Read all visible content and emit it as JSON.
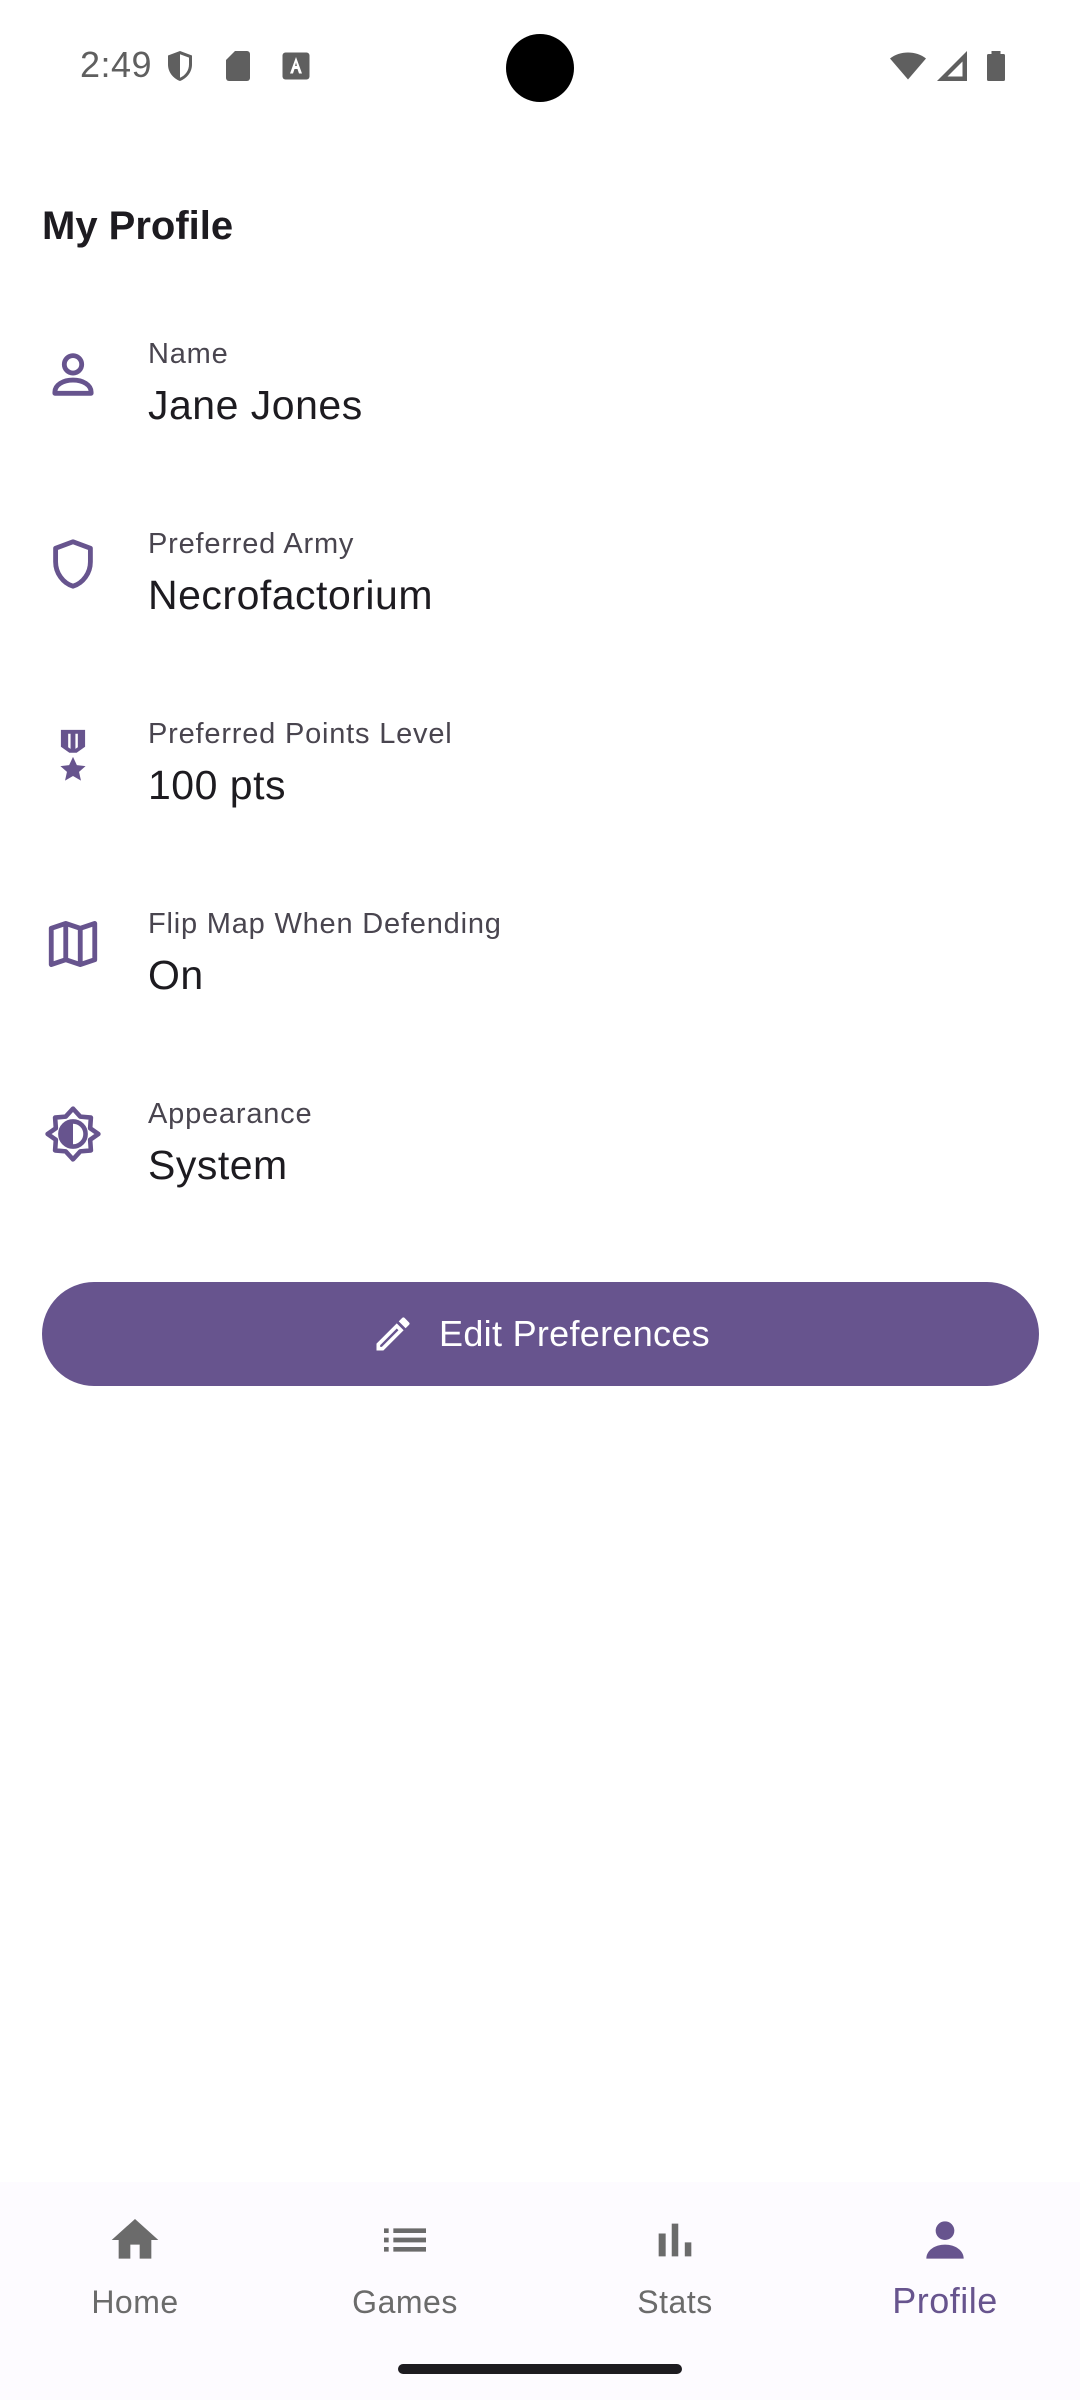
{
  "status_bar": {
    "time": "2:49",
    "icons_left": [
      "shield-icon",
      "sd-card-icon",
      "font-a-icon"
    ],
    "icons_right": [
      "wifi-icon",
      "signal-icon",
      "battery-icon"
    ]
  },
  "header": {
    "title": "My Profile"
  },
  "preferences": [
    {
      "icon": "person-icon",
      "label": "Name",
      "value": "Jane Jones"
    },
    {
      "icon": "shield-icon",
      "label": "Preferred Army",
      "value": "Necrofactorium"
    },
    {
      "icon": "medal-icon",
      "label": "Preferred Points Level",
      "value": "100 pts"
    },
    {
      "icon": "map-icon",
      "label": "Flip Map When Defending",
      "value": "On"
    },
    {
      "icon": "brightness-icon",
      "label": "Appearance",
      "value": "System"
    }
  ],
  "edit_button": {
    "icon": "pencil-icon",
    "label": "Edit Preferences"
  },
  "bottom_nav": {
    "items": [
      {
        "icon": "home-icon",
        "label": "Home"
      },
      {
        "icon": "list-icon",
        "label": "Games"
      },
      {
        "icon": "bar-chart-icon",
        "label": "Stats"
      },
      {
        "icon": "person-icon",
        "label": "Profile",
        "active": true
      }
    ]
  },
  "colors": {
    "accent": "#67548e",
    "icon_gray": "#5f5f5f",
    "text_primary": "#1d1b20",
    "text_secondary": "#49454f"
  }
}
